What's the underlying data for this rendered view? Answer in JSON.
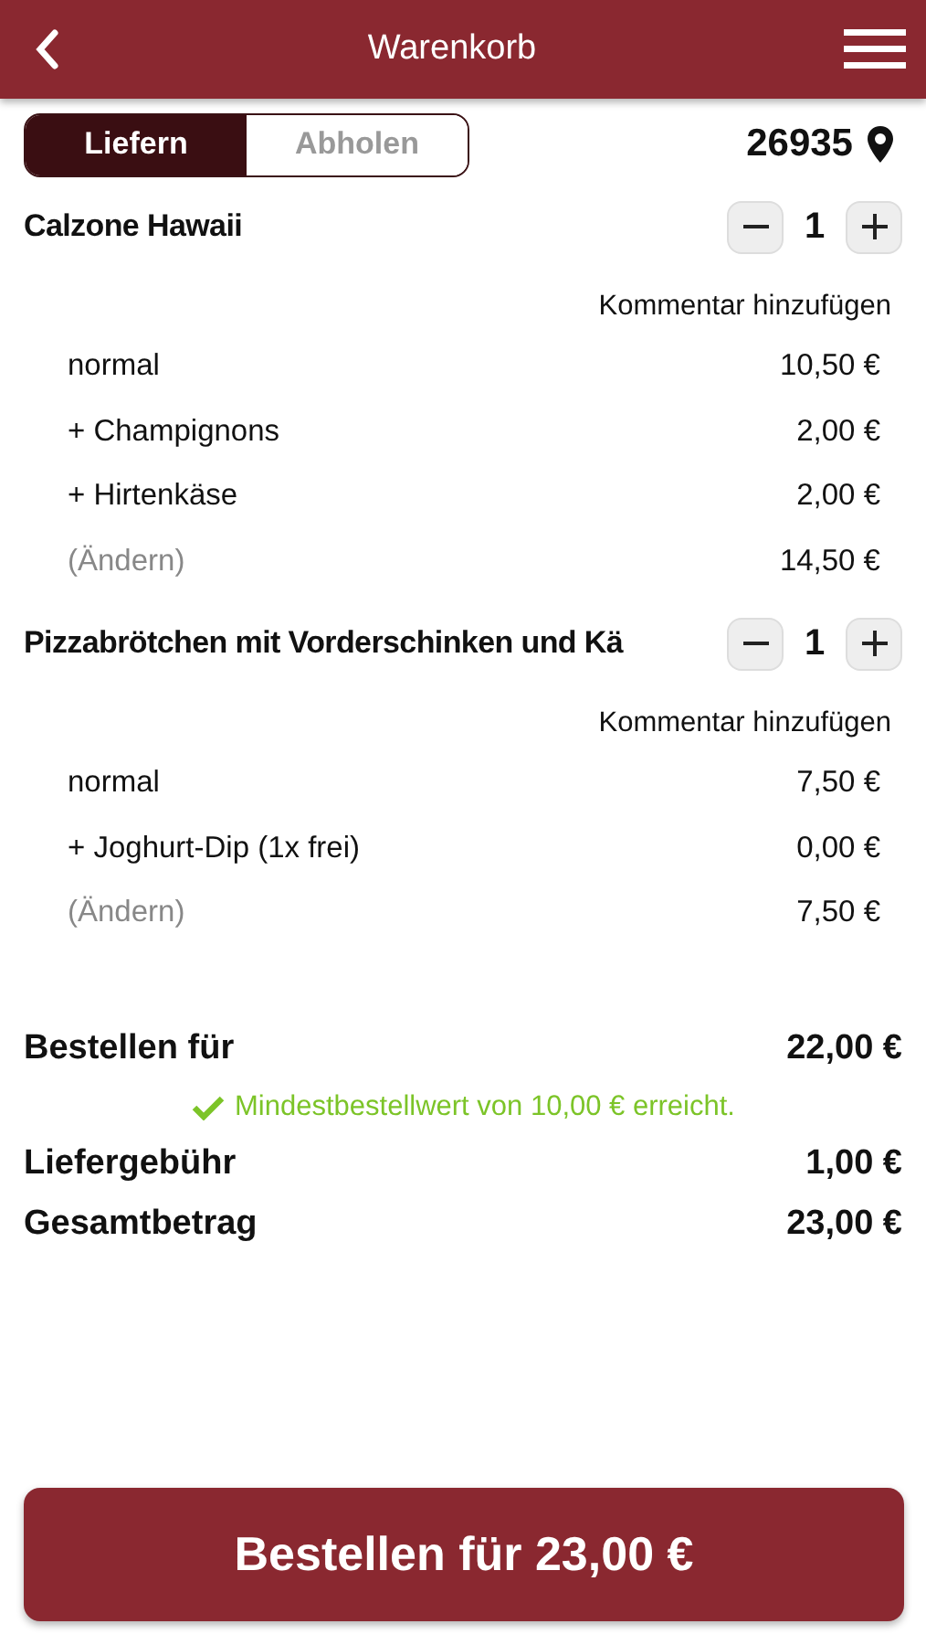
{
  "header": {
    "title": "Warenkorb"
  },
  "delivery_mode": {
    "tabs": [
      {
        "label": "Liefern",
        "selected": true
      },
      {
        "label": "Abholen",
        "selected": false
      }
    ]
  },
  "postal_code": "26935",
  "cart_items": [
    {
      "name": "Calzone Hawaii",
      "quantity": "1",
      "comment_link": "Kommentar hinzufügen",
      "lines": [
        {
          "kind": "option",
          "label": "normal",
          "price": "10,50 €"
        },
        {
          "kind": "option",
          "label": "+ Champignons",
          "price": "2,00 €"
        },
        {
          "kind": "option",
          "label": "+ Hirtenkäse",
          "price": "2,00 €"
        },
        {
          "kind": "edit",
          "label": "(Ändern)",
          "price": "14,50 €"
        }
      ]
    },
    {
      "name": "Pizzabrötchen mit Vorderschinken und Kä",
      "quantity": "1",
      "comment_link": "Kommentar hinzufügen",
      "lines": [
        {
          "kind": "option",
          "label": "normal",
          "price": "7,50 €"
        },
        {
          "kind": "option",
          "label": "+ Joghurt-Dip (1x frei)",
          "price": "0,00 €"
        },
        {
          "kind": "edit",
          "label": "(Ändern)",
          "price": "7,50 €"
        }
      ]
    }
  ],
  "summary": [
    {
      "kind": "total",
      "label": "Bestellen für",
      "value": "22,00 €"
    },
    {
      "kind": "notice",
      "text": "Mindestbestellwert von 10,00 € erreicht."
    },
    {
      "kind": "total",
      "label": "Liefergebühr",
      "value": "1,00 €"
    },
    {
      "kind": "total",
      "label": "Gesamtbetrag",
      "value": "23,00 €"
    }
  ],
  "order_button": "Bestellen für 23,00 €"
}
